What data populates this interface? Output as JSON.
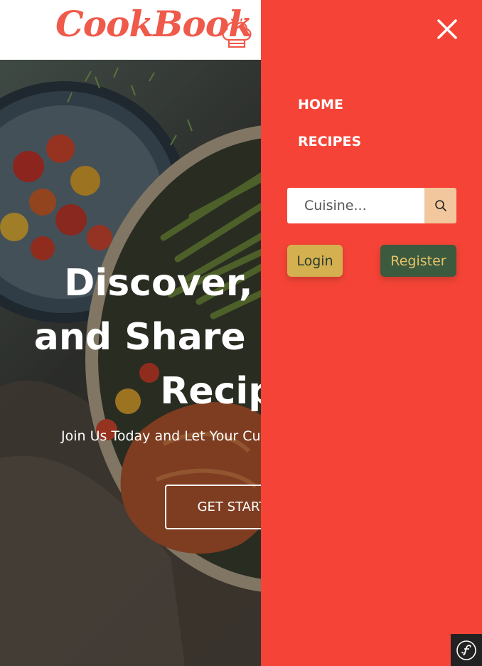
{
  "header": {
    "logo_text": "CookBook",
    "logo_color": "#ef5a4a",
    "logo_icon": "chef-hat-icon"
  },
  "hero": {
    "title_line1": "Discover, Create,",
    "title_line2": "and Share Delicious",
    "title_line3": "Recipes",
    "subtitle": "Join Us Today and Let Your Culinary Adventure Begin!",
    "cta_label": "GET STARTED"
  },
  "drawer": {
    "background": "#f54437",
    "close_icon": "close-icon",
    "nav": [
      {
        "label": "HOME"
      },
      {
        "label": "RECIPES"
      }
    ],
    "search": {
      "placeholder": "Cuisine...",
      "value": "",
      "button_icon": "search-icon"
    },
    "login_label": "Login",
    "register_label": "Register",
    "login_color": "#d4b050",
    "register_color": "#3b5a3e"
  },
  "debug_badge": {
    "icon": "symfony-icon"
  }
}
